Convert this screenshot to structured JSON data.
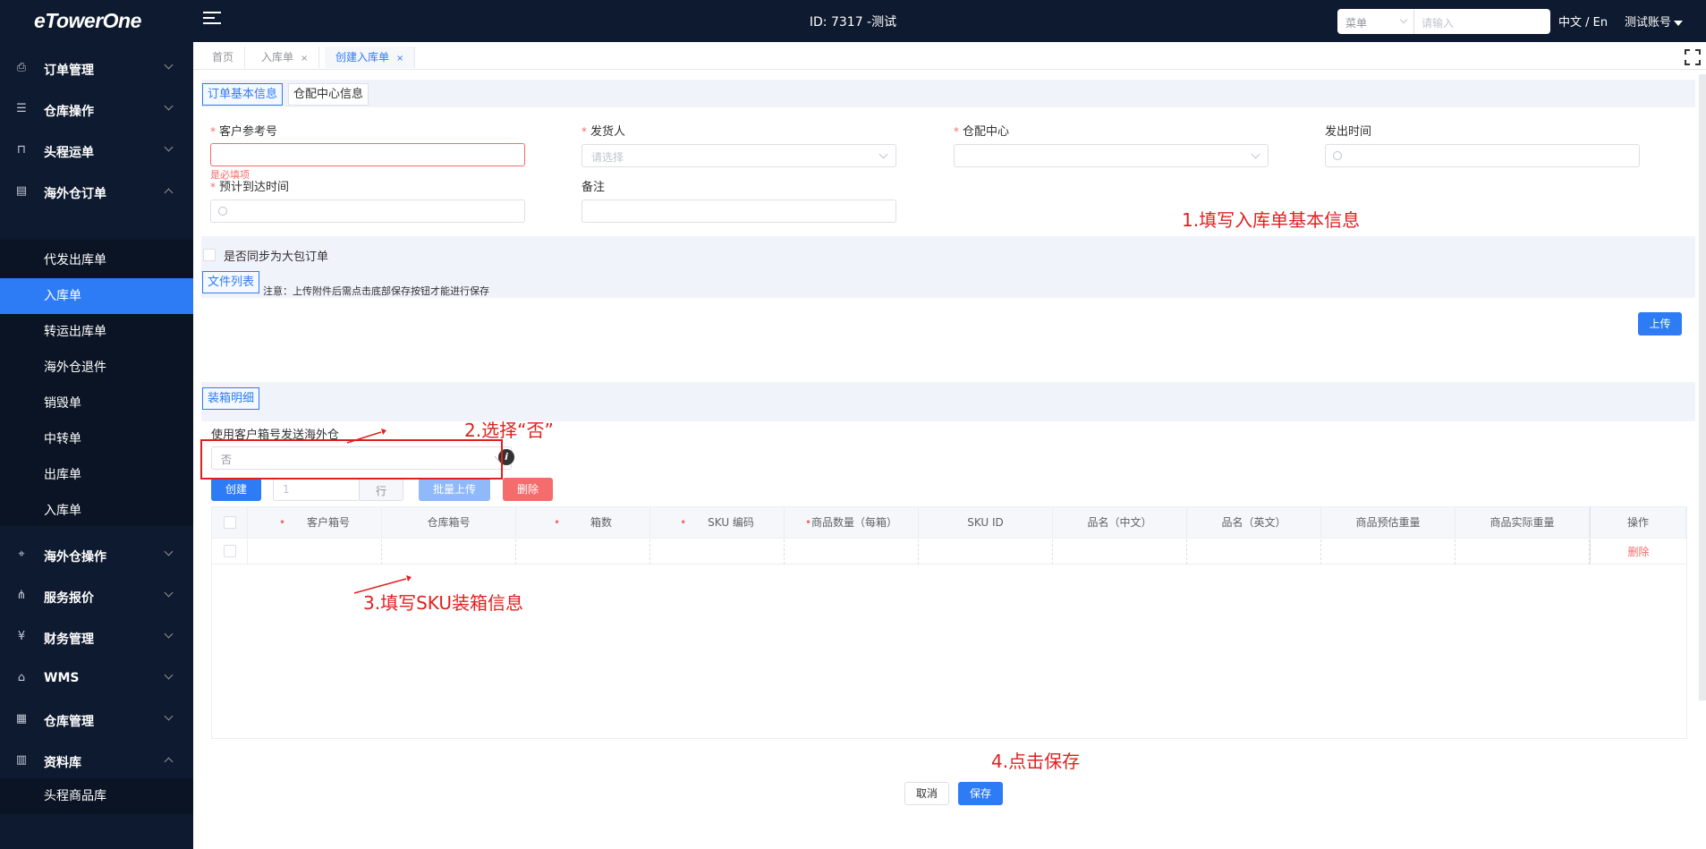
{
  "header": {
    "logo": "eTowerOne",
    "title": "ID: 7317 -测试",
    "search_select": "菜单",
    "search_placeholder": "请输入",
    "lang": "中文 / En",
    "user": "测试账号"
  },
  "sidebar": {
    "items": [
      {
        "label": "订单管理",
        "icon": "order-icon",
        "expanded": false
      },
      {
        "label": "仓库操作",
        "icon": "warehouse-icon",
        "expanded": false
      },
      {
        "label": "头程运单",
        "icon": "lock-icon",
        "expanded": false
      },
      {
        "label": "海外仓订单",
        "icon": "document-icon",
        "expanded": true
      },
      {
        "label": "海外仓操作",
        "icon": "pin-icon",
        "expanded": false
      },
      {
        "label": "服务报价",
        "icon": "network-icon",
        "expanded": false
      },
      {
        "label": "财务管理",
        "icon": "yuan-icon",
        "expanded": false
      },
      {
        "label": "WMS",
        "icon": "home-icon",
        "expanded": false
      },
      {
        "label": "仓库管理",
        "icon": "building-icon",
        "expanded": false
      },
      {
        "label": "资料库",
        "icon": "grid-icon",
        "expanded": true
      }
    ],
    "subitems": [
      "代发出库单",
      "入库单",
      "转运出库单",
      "海外仓退件",
      "销毁单",
      "中转单",
      "出库单",
      "入库单"
    ],
    "bottom_sub": "头程商品库"
  },
  "tabs": [
    {
      "label": "首页"
    },
    {
      "label": "入库单",
      "closable": true
    },
    {
      "label": "创建入库单",
      "closable": true,
      "active": true
    }
  ],
  "form": {
    "sec_basic": "订单基本信息",
    "sec_center": "仓配中心信息",
    "customer_ref": "客户参考号",
    "required_msg": "是必填项",
    "shipper": "发货人",
    "shipper_placeholder": "请选择",
    "center": "仓配中心",
    "send_time": "发出时间",
    "eta": "预计到达时间",
    "remark": "备注",
    "sync_label": "是否同步为大包订单",
    "file_list": "文件列表",
    "upload_note": "注意：上传附件后需点击底部保存按钮才能进行保存",
    "upload_btn": "上传",
    "packing": "装箱明细",
    "use_box_label": "使用客户箱号发送海外仓",
    "use_box_value": "否",
    "create_btn": "创建",
    "rows_value": "1",
    "rows_unit": "行",
    "batch_upload": "批量上传",
    "delete_btn": "删除"
  },
  "table": {
    "columns": [
      "客户箱号",
      "仓库箱号",
      "箱数",
      "SKU 编码",
      "商品数量（每箱）",
      "SKU ID",
      "品名（中文）",
      "品名（英文）",
      "商品预估重量",
      "商品实际重量",
      "操作"
    ],
    "row_action": "删除"
  },
  "footer": {
    "cancel": "取消",
    "save": "保存"
  },
  "annotations": {
    "a1": "1.填写入库单基本信息",
    "a2": "2.选择“否”",
    "a3": "3.填写SKU装箱信息",
    "a4": "4.点击保存"
  }
}
